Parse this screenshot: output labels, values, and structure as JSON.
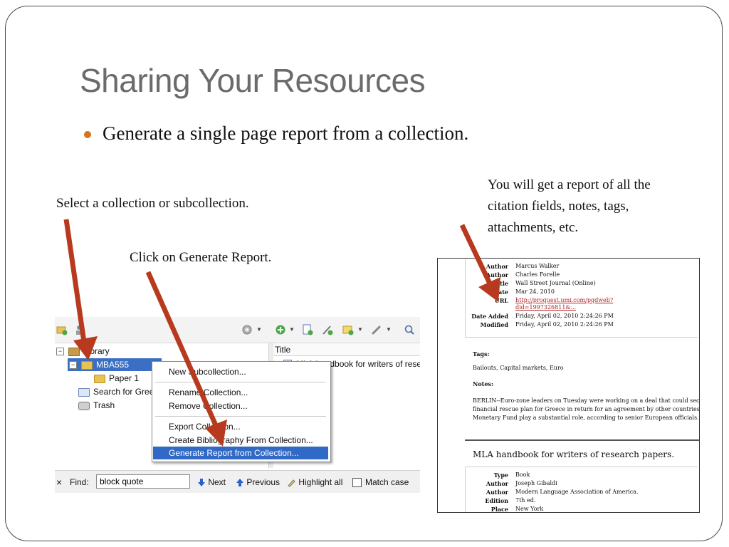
{
  "slide": {
    "title": "Sharing Your Resources",
    "bullet": "Generate a single page report from a collection.",
    "notes": {
      "select": "Select a collection or subcollection.",
      "click": "Click on Generate Report.",
      "report": "You will get a report of all the citation fields, notes, tags, attachments, etc."
    },
    "accent_color": "#d8731e",
    "arrow_color": "#b83a1e"
  },
  "app": {
    "toolbar_icons": [
      "new-collection-icon",
      "new-group-icon",
      "actions-gear-icon",
      "new-item-icon",
      "new-note-icon",
      "attach-icon",
      "link-icon",
      "search-icon"
    ],
    "tree": {
      "library": "Library",
      "collection": "MBA555",
      "subcollection": "Paper 1",
      "saved_search": "Search for Gree",
      "trash": "Trash"
    },
    "items": {
      "column_title": "Title",
      "row": "MLA handbook for writers of rese"
    },
    "context_menu": {
      "new_subcollection": "New Subcollection...",
      "rename": "Rename Collection...",
      "remove": "Remove Collection...",
      "export": "Export Collection...",
      "create_bib": "Create Bibliography From Collection...",
      "generate_report": "Generate Report from Collection..."
    },
    "findbar": {
      "close": "×",
      "label": "Find:",
      "value": "block quote",
      "next": "Next",
      "previous": "Previous",
      "highlight": "Highlight all",
      "match_case": "Match case"
    }
  },
  "report": {
    "item1": {
      "fields": [
        {
          "label": "Author",
          "value": "Marcus Walker"
        },
        {
          "label": "Author",
          "value": "Charles Forelle"
        },
        {
          "label": "Title",
          "value": "Wall Street Journal (Online)"
        },
        {
          "label": "Date",
          "value": "Mar 24, 2010"
        },
        {
          "label": "URL",
          "value": "http://proquest.umi.com/pqdweb?",
          "value2": "did=1997326811&..."
        },
        {
          "label": "Date Added",
          "value": "Friday, April 02, 2010 2:24:26 PM"
        },
        {
          "label": "Modified",
          "value": "Friday, April 02, 2010 2:24:26 PM"
        }
      ],
      "tags_heading": "Tags:",
      "tags": "Bailouts, Capital markets, Euro",
      "notes_heading": "Notes:",
      "notes_lines": [
        "BERLIN--Euro-zone leaders on Tuesday were working on a deal that could secure G",
        "financial rescue plan for Greece in return for an agreement by other countries to let",
        "Monetary Fund play a substantial role, according to senior European officials."
      ]
    },
    "item2": {
      "title": "MLA handbook for writers of research papers.",
      "fields": [
        {
          "label": "Type",
          "value": "Book"
        },
        {
          "label": "Author",
          "value": "Joseph Gibaldi"
        },
        {
          "label": "Author",
          "value": "Modern Language Association of America."
        },
        {
          "label": "Edition",
          "value": "7th ed."
        },
        {
          "label": "Place",
          "value": "New York"
        }
      ]
    }
  }
}
